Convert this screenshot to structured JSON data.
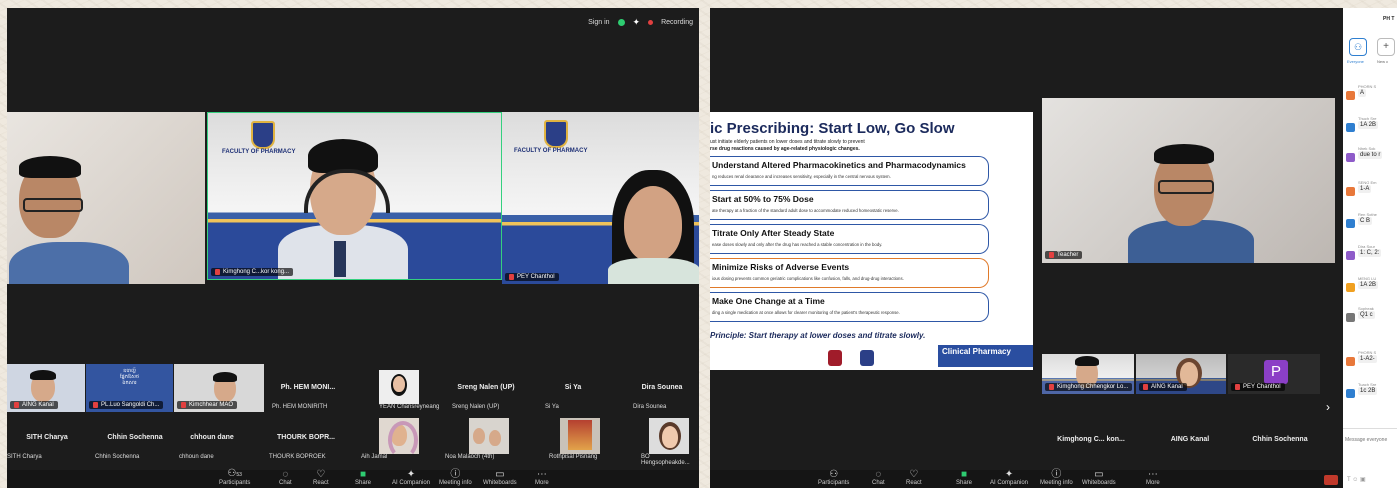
{
  "left": {
    "top_bar": {
      "sign_in": "Sign in",
      "recording": "Recording"
    },
    "speaker_tiles": [
      {
        "label": "Kimghong C...kor kong..."
      },
      {
        "label": "PEY Chanthol"
      }
    ],
    "banner_text": "FACULTY OF PHARMACY",
    "gallery_row1": [
      {
        "name": "Ph. HEM MONI...",
        "sub": "Ph. HEM MONIRITH"
      },
      {
        "name": "",
        "sub": "YEAN Chansreyneang"
      },
      {
        "name": "Sreng Nalen (UP)",
        "sub": "Sreng Nalen (UP)"
      },
      {
        "name": "Si Ya",
        "sub": "Si Ya"
      },
      {
        "name": "Dira Sounea",
        "sub": "Dira Sounea"
      }
    ],
    "gallery_row1_thumbs": [
      "AING Kanal",
      "PL.Luo Sangoldi Ch...",
      "Kimchhear MAO"
    ],
    "gallery_row2": [
      {
        "name": "SITH Charya",
        "sub": "SITH Charya"
      },
      {
        "name": "Chhin Sochenna",
        "sub": "Chhin Sochenna"
      },
      {
        "name": "chhoun dane",
        "sub": "chhoun dane"
      },
      {
        "name": "THOURK BOPR...",
        "sub": "THOURK BOPROEK"
      },
      {
        "name": "",
        "sub": "Aih Jamal"
      },
      {
        "name": "",
        "sub": "Noa Malaoch (4th)"
      },
      {
        "name": "",
        "sub": "Rothpisal Pisnang"
      },
      {
        "name": "",
        "sub": "BO Hengsopheakde..."
      }
    ],
    "toolbar": [
      "Participants",
      "Chat",
      "React",
      "Share",
      "AI Companion",
      "Meeting info",
      "Whiteboards",
      "More"
    ],
    "participant_count": "53"
  },
  "right": {
    "slide": {
      "title": "ic Prescribing: Start Low, Go Slow",
      "sub1": "ust initiate elderly patients on lower doses and titrate slowly to prevent",
      "sub2": "rse drug reactions caused by age-related physiologic changes.",
      "items": [
        {
          "h": "Understand Altered Pharmacokinetics and Pharmacodynamics",
          "t": "ng reduces renal clearance and increases sensitivity, especially in the central nervous system."
        },
        {
          "h": "Start at 50% to 75% Dose",
          "t": "ate therapy at a fraction of the standard adult dose to accommodate reduced homeostatic reserve."
        },
        {
          "h": "Titrate Only After Steady State",
          "t": "ease doses slowly and only after the drug has reached a stable concentration in the body."
        },
        {
          "h": "Minimize Risks of Adverse Events",
          "t": "ious dosing prevents common geriatric complications like confusion, falls, and drug-drug interactions."
        },
        {
          "h": "Make One Change at a Time",
          "t": "ding a single medication at once allows for clearer monitoring of the patient's therapeutic response."
        }
      ],
      "principle": "Principle: Start therapy at lower doses and titrate slowly.",
      "brand": "Clinical Pharmacy"
    },
    "speaker_label": "Teacher",
    "thumbs": [
      "Kimghong Chhengkor Lo...",
      "AING Kanal",
      "PEY Chanthol"
    ],
    "thumb_letter": "P",
    "name_row": [
      "Kimghong C... kon...",
      "AING Kanal",
      "Chhin Sochenna"
    ],
    "toolbar": [
      "Participants",
      "Chat",
      "React",
      "Share",
      "AI Companion",
      "Meeting info",
      "Whiteboards",
      "More"
    ]
  },
  "chat": {
    "header": "PH T",
    "tabs": [
      "Everyone",
      "New c"
    ],
    "messages": [
      {
        "name": "PHORN S",
        "text": "A",
        "color": "#e8783a"
      },
      {
        "name": "Thuch Sre",
        "text": "1A 2B",
        "color": "#2f7fd0"
      },
      {
        "name": "Nhek Sok",
        "text": "due to r",
        "color": "#8e5bc9"
      },
      {
        "name": "SENG Em",
        "text": "1-A",
        "color": "#e8783a"
      },
      {
        "name": "Ren Sothe",
        "text": "C B",
        "color": "#2f7fd0"
      },
      {
        "name": "Dira Sour",
        "text": "1: C, 2:",
        "color": "#8e5bc9"
      },
      {
        "name": "MENG LU",
        "text": "1A 2B",
        "color": "#f0a020"
      },
      {
        "name": "Sopheak",
        "text": "Q1 c",
        "color": "#777777"
      },
      {
        "name": "PHORN S",
        "text": "1-A2-",
        "color": "#e8783a"
      },
      {
        "name": "Tuach Sre",
        "text": "1c 2B",
        "color": "#2f7fd0"
      }
    ],
    "input_placeholder": "Message everyone"
  }
}
